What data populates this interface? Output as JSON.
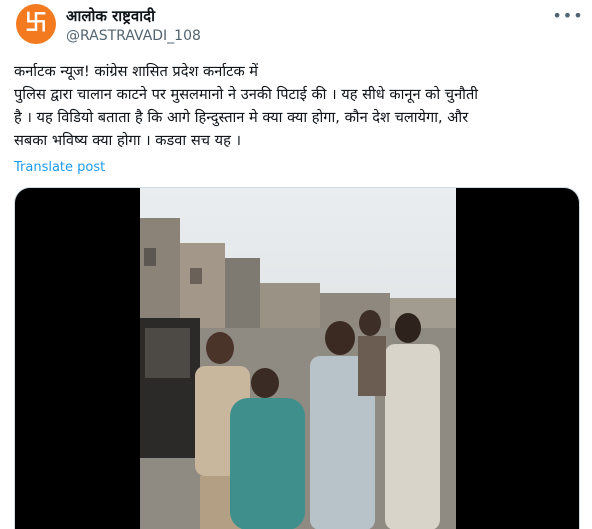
{
  "author": {
    "avatar_glyph": "卐",
    "avatar_color": "#f47a1f",
    "display_name": "आलोक राष्ट्रवादी",
    "handle": "@RASTRAVADI_108"
  },
  "menu": {
    "more_icon": "more-horizontal-icon"
  },
  "post": {
    "text": "कर्नाटक न्यूज! कांग्रेस शासित प्रदेश कर्नाटक में\nपुलिस द्वारा चालान काटने पर मुसलमानो ने उनकी पिटाई की । यह सीधे कानून को चुनौती\nहै । यह विडियो बताता है कि आगे हिन्दुस्तान मे क्या क्या होगा, कौन देश चलायेगा, और\nसबका भविष्य क्या होगा । कडवा सच यह ।",
    "translate_label": "Translate post"
  },
  "colors": {
    "link": "#1d9bf0",
    "secondary_text": "#536471",
    "primary_text": "#0f1419"
  }
}
